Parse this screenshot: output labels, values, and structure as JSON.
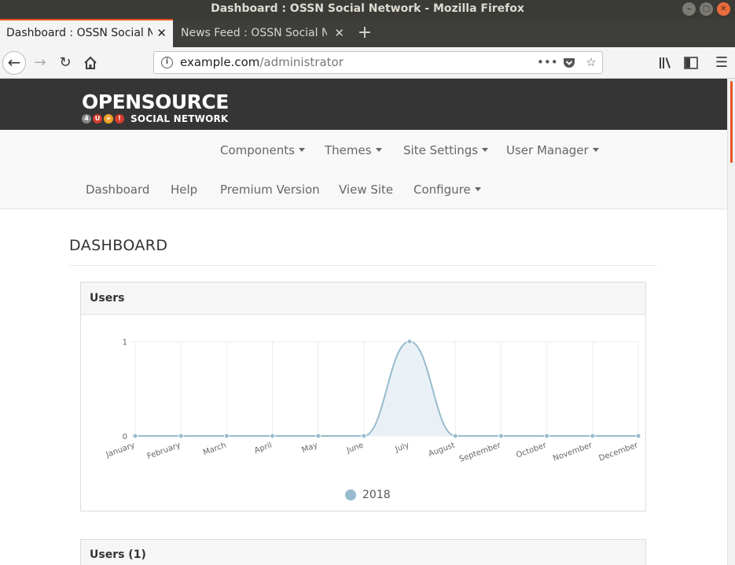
{
  "window": {
    "title": "Dashboard : OSSN Social Network - Mozilla Firefox"
  },
  "tabs": [
    {
      "label": "Dashboard : OSSN Social Network",
      "active": true
    },
    {
      "label": "News Feed : OSSN Social Network",
      "active": false
    }
  ],
  "navbar": {
    "url_host": "example.com",
    "url_path": "/administrator"
  },
  "logo": {
    "top": "OPENSOURCE",
    "badges": [
      "4",
      "U",
      "+",
      "!"
    ],
    "bottom": "SOCIAL NETWORK"
  },
  "admin_menu": {
    "row1": [
      "Components",
      "Themes",
      "Site Settings",
      "User Manager"
    ],
    "row2": [
      "Dashboard",
      "Help",
      "Premium Version",
      "View Site",
      "Configure"
    ]
  },
  "page": {
    "heading": "DASHBOARD"
  },
  "users_panel": {
    "title": "Users"
  },
  "users_list_panel": {
    "title": "Users (1)"
  },
  "colors": {
    "accent": "#e95420",
    "header_bg": "#353535",
    "series_line": "#97bbcd",
    "series_fill": "#e8eff5"
  },
  "chart_data": {
    "type": "line",
    "x": [
      "January",
      "February",
      "March",
      "April",
      "May",
      "June",
      "July",
      "August",
      "September",
      "October",
      "November",
      "December"
    ],
    "series": [
      {
        "name": "2018",
        "values": [
          0,
          0,
          0,
          0,
          0,
          0,
          1,
          0,
          0,
          0,
          0,
          0
        ]
      }
    ],
    "y_ticks": [
      "0",
      "1"
    ],
    "ylim": [
      0,
      1
    ],
    "grid": true,
    "legend": "bottom-center"
  }
}
